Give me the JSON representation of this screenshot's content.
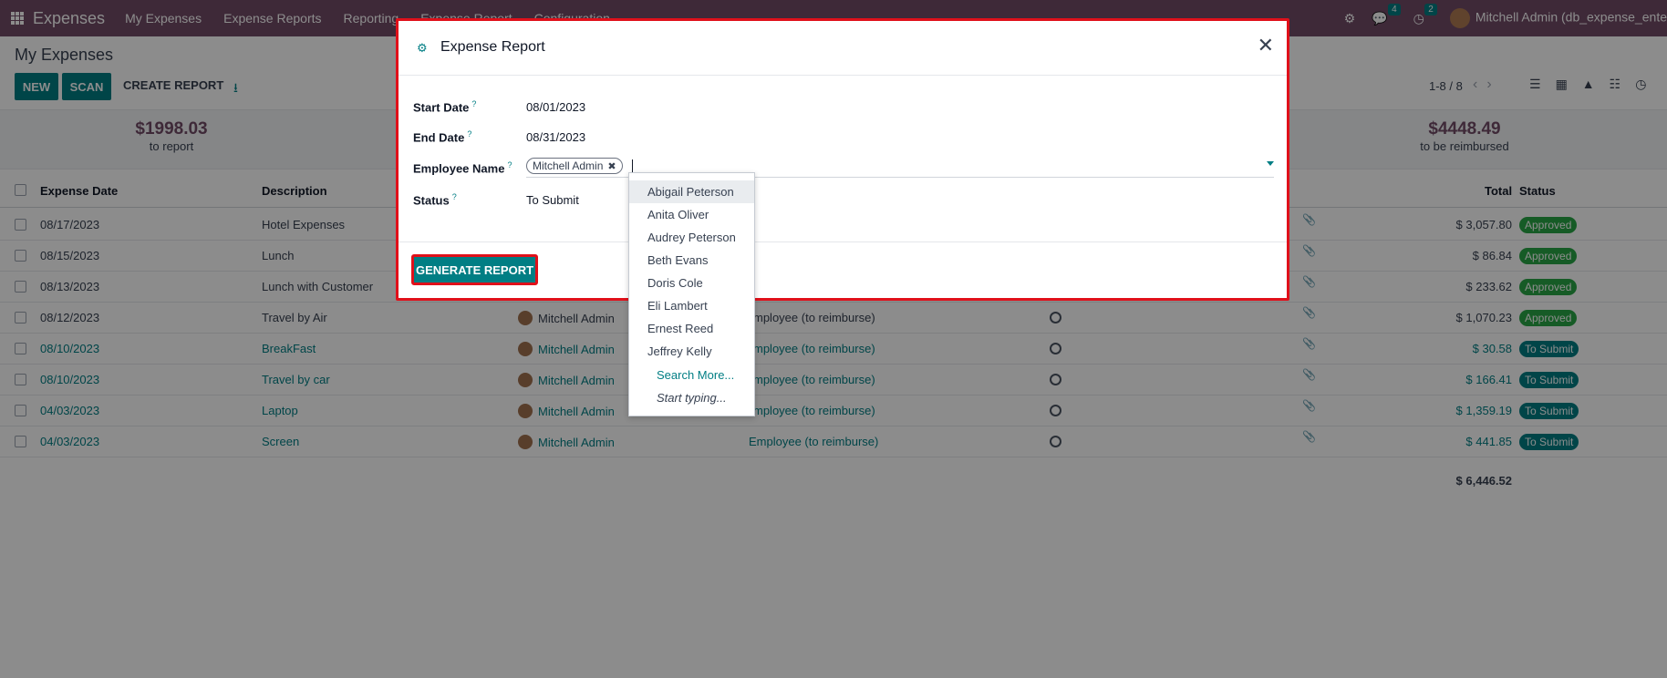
{
  "app": {
    "brand": "Expenses",
    "menu": [
      "My Expenses",
      "Expense Reports",
      "Reporting",
      "Expense Report",
      "Configuration"
    ],
    "messages_count": "4",
    "activities_count": "2",
    "user": "Mitchell Admin (db_expense_ente"
  },
  "control": {
    "title": "My Expenses",
    "new_label": "NEW",
    "scan_label": "SCAN",
    "create_report_label": "CREATE REPORT",
    "pager": "1-8 / 8"
  },
  "summary": {
    "to_report_value": "$1998.03",
    "to_report_label": "to report",
    "reimbursed_value": "$4448.49",
    "reimbursed_label": "to be reimbursed"
  },
  "table": {
    "headers": {
      "date": "Expense Date",
      "description": "Description",
      "total": "Total",
      "status": "Status"
    },
    "rows": [
      {
        "date": "08/17/2023",
        "description": "Hotel Expenses",
        "employee": "",
        "paid_by": "",
        "total": "$ 3,057.80",
        "status": "Approved",
        "link": false
      },
      {
        "date": "08/15/2023",
        "description": "Lunch",
        "employee": "",
        "paid_by": "",
        "total": "$ 86.84",
        "status": "Approved",
        "link": false
      },
      {
        "date": "08/13/2023",
        "description": "Lunch with Customer",
        "employee": "",
        "paid_by": "",
        "total": "$ 233.62",
        "status": "Approved",
        "link": false
      },
      {
        "date": "08/12/2023",
        "description": "Travel by Air",
        "employee": "Mitchell Admin",
        "paid_by": "mployee (to reimburse)",
        "total": "$ 1,070.23",
        "status": "Approved",
        "link": false
      },
      {
        "date": "08/10/2023",
        "description": "BreakFast",
        "employee": "Mitchell Admin",
        "paid_by": "mployee (to reimburse)",
        "total": "$ 30.58",
        "status": "To Submit",
        "link": true
      },
      {
        "date": "08/10/2023",
        "description": "Travel by car",
        "employee": "Mitchell Admin",
        "paid_by": "mployee (to reimburse)",
        "total": "$ 166.41",
        "status": "To Submit",
        "link": true
      },
      {
        "date": "04/03/2023",
        "description": "Laptop",
        "employee": "Mitchell Admin",
        "paid_by": "mployee (to reimburse)",
        "total": "$ 1,359.19",
        "status": "To Submit",
        "link": true
      },
      {
        "date": "04/03/2023",
        "description": "Screen",
        "employee": "Mitchell Admin",
        "paid_by": "Employee (to reimburse)",
        "total": "$ 441.85",
        "status": "To Submit",
        "link": true
      }
    ],
    "grand_total": "$ 6,446.52"
  },
  "colors": {
    "brand": "#714b67",
    "primary": "#017e84",
    "approved": "#28a745",
    "to_submit": "#017e84",
    "highlight": "#e0101a"
  },
  "modal": {
    "title": "Expense Report",
    "start_date_label": "Start Date",
    "start_date_value": "08/01/2023",
    "end_date_label": "End Date",
    "end_date_value": "08/31/2023",
    "employee_label": "Employee Name",
    "employee_tag": "Mitchell Admin",
    "status_label": "Status",
    "status_value": "To Submit",
    "help_mark": "?",
    "generate_label": "GENERATE REPORT"
  },
  "dropdown": {
    "items": [
      "Abigail Peterson",
      "Anita Oliver",
      "Audrey Peterson",
      "Beth Evans",
      "Doris Cole",
      "Eli Lambert",
      "Ernest Reed",
      "Jeffrey Kelly"
    ],
    "search_more": "Search More...",
    "start_typing": "Start typing..."
  }
}
